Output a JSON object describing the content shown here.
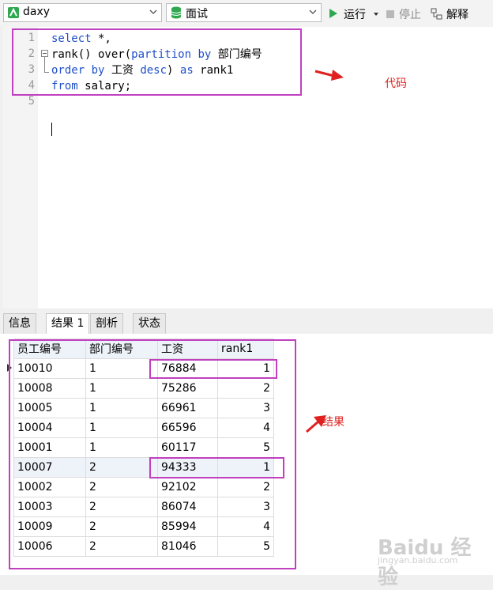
{
  "toolbar": {
    "connection": "daxy",
    "query": "面试",
    "run_label": "运行",
    "stop_label": "停止",
    "explain_label": "解释"
  },
  "editor": {
    "line_numbers": [
      "1",
      "2",
      "3",
      "4",
      "5"
    ]
  },
  "tabs": [
    "信息",
    "结果 1",
    "剖析",
    "状态"
  ],
  "grid": {
    "columns": [
      "员工编号",
      "部门编号",
      "工资",
      "rank1"
    ],
    "rows": [
      [
        "10010",
        "1",
        "76884",
        "1"
      ],
      [
        "10008",
        "1",
        "75286",
        "2"
      ],
      [
        "10005",
        "1",
        "66961",
        "3"
      ],
      [
        "10004",
        "1",
        "66596",
        "4"
      ],
      [
        "10001",
        "1",
        "60117",
        "5"
      ],
      [
        "10007",
        "2",
        "94333",
        "1"
      ],
      [
        "10002",
        "2",
        "92102",
        "2"
      ],
      [
        "10003",
        "2",
        "86074",
        "3"
      ],
      [
        "10009",
        "2",
        "85994",
        "4"
      ],
      [
        "10006",
        "2",
        "81046",
        "5"
      ]
    ]
  },
  "annotations": {
    "code_label": "代码",
    "result_label": "结果",
    "color": "#e0201e",
    "box_color": "#c040c0"
  },
  "watermark": {
    "text": "Baidu 经验",
    "sub": "jingyan.baidu.com"
  }
}
